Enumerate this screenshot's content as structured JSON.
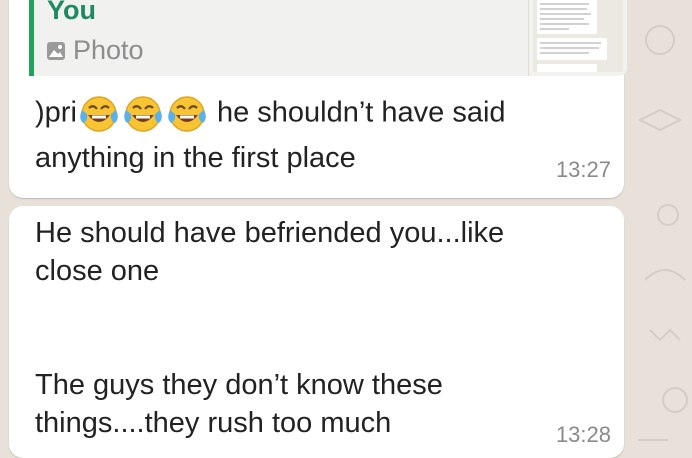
{
  "colors": {
    "wallpaper": "#e7e1d9",
    "bubble": "#ffffff",
    "quote_accent": "#21a35b",
    "quote_author": "#1e8a63"
  },
  "messages": [
    {
      "quote": {
        "author": "You",
        "type_icon": "photo-icon",
        "type_label": "Photo"
      },
      "text_before_emoji": ")pri",
      "emoji": [
        "face-with-tears-of-joy",
        "face-with-tears-of-joy",
        "face-with-tears-of-joy"
      ],
      "text_after_emoji": " he shouldn’t have said",
      "text_line2": "anything in the first place",
      "time": "13:27"
    },
    {
      "lines": [
        "He should have befriended you...like",
        "close one",
        "",
        "",
        "The guys they don’t know these",
        "things....they rush too much"
      ],
      "time": "13:28"
    }
  ]
}
